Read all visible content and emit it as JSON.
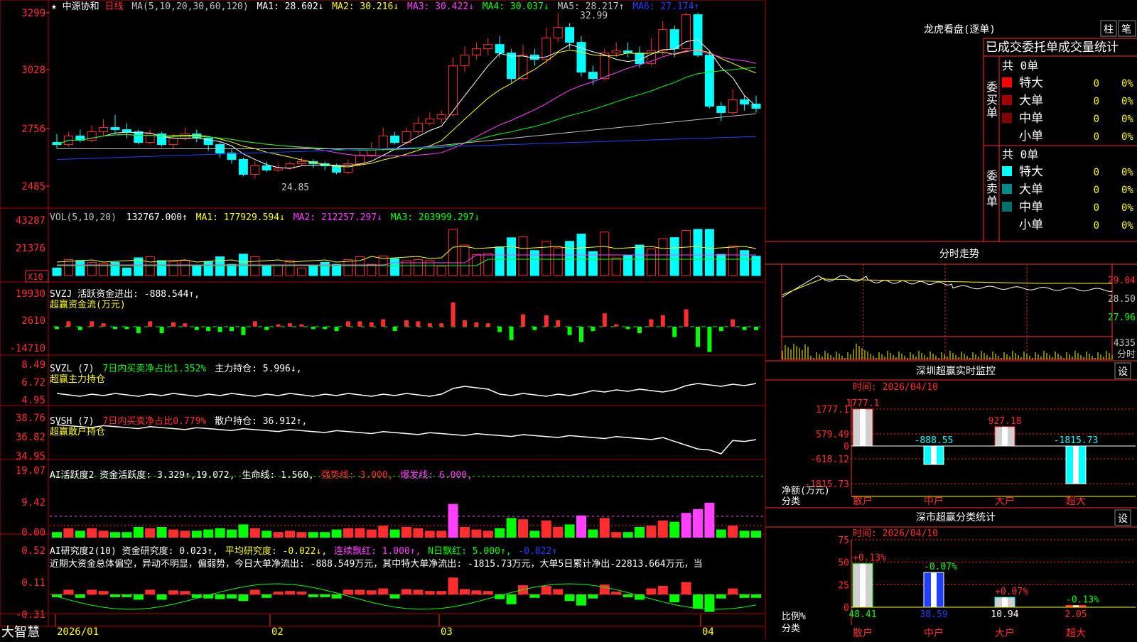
{
  "colors": {
    "up": "#ff2d2d",
    "down": "#00ffff",
    "grid": "#8b0000",
    "text": "#c0c0c0",
    "yellow": "#ffff00",
    "magenta": "#ff40ff",
    "green": "#00ff00",
    "white": "#ffffff",
    "blue": "#2040ff",
    "teal": "#008080"
  },
  "header": {
    "star": "★",
    "stock_name": "中源协和",
    "period": "日线",
    "ma_params": "MA(5,10,20,30,60,120)",
    "ma1": "MA1: 28.602↓",
    "ma2": "MA2: 30.216↓",
    "ma3": "MA3: 30.422↓",
    "ma4": "MA4: 30.037↓",
    "ma5": "MA5: 28.217↑",
    "ma6": "MA6: 27.174↑"
  },
  "kline": {
    "y_ticks": [
      "3299",
      "3028",
      "2756",
      "2485"
    ],
    "high_label": "32.99",
    "low_label": "24.85"
  },
  "volume": {
    "title": "VOL(5,10,20)",
    "value": "132767.000↑",
    "ma1": "MA1: 177929.594↓",
    "ma2": "MA2: 212257.297↓",
    "ma3": "MA3: 203999.297↓",
    "y_ticks": [
      "43287",
      "21376"
    ],
    "unit": "X10"
  },
  "svzj": {
    "line1": "SVZJ  活跃资金进出: -888.544↑,",
    "line2": "超赢资金流(万元)",
    "y_ticks": [
      "19930",
      "2610",
      "-14710"
    ]
  },
  "svzl": {
    "prefix": "SVZL (7)",
    "highlight": "7日内买卖净占比1.352%",
    "tail": "主力持仓: 5.996↓,",
    "line2": "超赢主力持仓",
    "y_ticks": [
      "8.49",
      "6.72",
      "4.95"
    ]
  },
  "svsh": {
    "prefix": "SVSH (7)",
    "highlight": "7日内买卖净占比0.779%",
    "tail": "散户持仓: 36.912↑,",
    "line2": "超赢散户持仓",
    "y_ticks": [
      "38.76",
      "36.82",
      "34.95"
    ]
  },
  "ai_active": {
    "title": "AI活跃度2 资金活跃度: 3.329↑,19.072,",
    "life": "生命线: 1.560,",
    "strong": "强势线: 3.000,",
    "burst": "爆发线: 6.000,",
    "y_ticks": [
      "19.07",
      "9.42",
      "0.00"
    ]
  },
  "ai_research": {
    "title": "AI研究度2(10) 资金研究度: 0.023↑,",
    "avg": "平均研究度: -0.022↓,",
    "cont": "连续飘红: 1.000↑,",
    "nday": "N日飘红: 5.000↑,",
    "last": "-0.022↑",
    "comment": "近期大资金总体偏空，异动不明显，偏弱势，今日大单净流出: -888.549万元，其中特大单净流出: -1815.73万元，大单5日累计净出-22813.664万元，当",
    "y_ticks": [
      "0.52",
      "0.11",
      "-0.31"
    ]
  },
  "xaxis": {
    "labels": [
      "2026/01",
      "02",
      "03",
      "04"
    ],
    "brand": "大智慧"
  },
  "right_top": {
    "title": "龙虎看盘(逐单)",
    "btn_bar": "柱",
    "btn_pen": "笔",
    "header": "已成交委托单成交量统计",
    "buy": {
      "side_label": [
        "委",
        "买",
        "单"
      ],
      "total": "共 0单",
      "rows": [
        {
          "name": "特大",
          "count": "0",
          "pct": "0%"
        },
        {
          "name": "大单",
          "count": "0",
          "pct": "0%"
        },
        {
          "name": "中单",
          "count": "0",
          "pct": "0%"
        },
        {
          "name": "小单",
          "count": "0",
          "pct": "0%"
        }
      ]
    },
    "sell": {
      "side_label": [
        "委",
        "卖",
        "单"
      ],
      "total": "共 0单",
      "rows": [
        {
          "name": "特大",
          "count": "0",
          "pct": "0%"
        },
        {
          "name": "大单",
          "count": "0",
          "pct": "0%"
        },
        {
          "name": "中单",
          "count": "0",
          "pct": "0%"
        },
        {
          "name": "小单",
          "count": "0",
          "pct": "0%"
        }
      ]
    }
  },
  "intraday": {
    "title": "分时走势",
    "y_ticks": [
      "29.04",
      "28.50",
      "27.96"
    ],
    "vol_label": "4335",
    "vol_unit": "分时"
  },
  "monitor": {
    "title": "深圳超赢实时监控",
    "btn": "设",
    "time": "时间: 2026/04/10",
    "y_ticks": [
      "1777.1",
      "579.49",
      "0",
      "-618.12",
      "-1815.73"
    ],
    "ylabel1": "净额(万元)",
    "ylabel2": "分类",
    "categories": [
      "散户",
      "中户",
      "大户",
      "超大"
    ]
  },
  "classify": {
    "title": "深市超赢分类统计",
    "btn": "设",
    "time": "时间: 2026/04/10",
    "y_ticks": [
      "75",
      "50",
      "25",
      "0"
    ],
    "ylabel1": "比例%",
    "ylabel2": "分类",
    "categories": [
      "散户",
      "中户",
      "大户",
      "超大"
    ]
  },
  "chart_data": [
    {
      "type": "bar",
      "title": "深圳超赢实时监控",
      "ylabel": "净额(万元)",
      "categories": [
        "散户",
        "中户",
        "大户",
        "超大"
      ],
      "values": [
        1777.1,
        -888.55,
        927.18,
        -1815.73
      ]
    },
    {
      "type": "bar",
      "title": "深市超赢分类统计",
      "ylabel": "比例%",
      "categories": [
        "散户",
        "中户",
        "大户",
        "超大"
      ],
      "values": [
        48.41,
        38.59,
        10.94,
        2.05
      ],
      "change_labels": [
        "+0.13%",
        "-0.07%",
        "+0.07%",
        "-0.13%"
      ],
      "ylim": [
        0,
        75
      ]
    },
    {
      "type": "candlestick",
      "title": "中源协和 日线",
      "ylim": [
        24.85,
        32.99
      ],
      "candles": [
        [
          26.9,
          26.8,
          27.3,
          26.6
        ],
        [
          26.8,
          27.2,
          27.4,
          26.7
        ],
        [
          27.2,
          27.0,
          27.5,
          26.9
        ],
        [
          27.0,
          27.4,
          27.7,
          26.9
        ],
        [
          27.4,
          27.6,
          28.0,
          27.2
        ],
        [
          27.6,
          27.5,
          28.2,
          27.3
        ],
        [
          27.5,
          27.4,
          27.8,
          27.1
        ],
        [
          27.4,
          26.9,
          27.5,
          26.8
        ],
        [
          26.9,
          27.3,
          27.5,
          26.8
        ],
        [
          27.3,
          26.8,
          27.4,
          26.7
        ],
        [
          26.8,
          27.1,
          27.3,
          26.6
        ],
        [
          27.1,
          27.3,
          27.6,
          27.0
        ],
        [
          27.3,
          27.1,
          27.5,
          26.9
        ],
        [
          27.1,
          26.8,
          27.2,
          26.5
        ],
        [
          26.8,
          26.4,
          26.9,
          26.2
        ],
        [
          26.4,
          26.1,
          26.6,
          25.9
        ],
        [
          26.1,
          25.4,
          26.2,
          25.3
        ],
        [
          25.4,
          25.8,
          26.0,
          25.2
        ],
        [
          25.8,
          25.6,
          26.0,
          25.5
        ],
        [
          25.6,
          25.7,
          25.9,
          25.5
        ],
        [
          25.7,
          25.9,
          26.0,
          25.6
        ],
        [
          25.9,
          26.0,
          26.2,
          25.8
        ],
        [
          26.0,
          25.9,
          26.1,
          25.7
        ],
        [
          25.9,
          25.8,
          26.0,
          25.6
        ],
        [
          25.8,
          25.5,
          25.9,
          25.4
        ],
        [
          25.5,
          25.9,
          26.1,
          25.4
        ],
        [
          25.9,
          26.3,
          26.5,
          25.8
        ],
        [
          26.3,
          26.6,
          26.9,
          26.2
        ],
        [
          26.6,
          27.2,
          27.6,
          26.5
        ],
        [
          27.2,
          26.9,
          27.4,
          26.8
        ],
        [
          26.9,
          27.4,
          27.6,
          26.8
        ],
        [
          27.4,
          27.8,
          28.1,
          27.3
        ],
        [
          27.8,
          28.0,
          28.3,
          27.7
        ],
        [
          28.0,
          28.2,
          28.4,
          27.8
        ],
        [
          28.2,
          30.5,
          30.9,
          28.1
        ],
        [
          30.5,
          31.0,
          31.4,
          30.2
        ],
        [
          31.0,
          31.3,
          31.6,
          30.8
        ],
        [
          31.3,
          31.5,
          31.8,
          31.0
        ],
        [
          31.5,
          31.1,
          31.9,
          30.9
        ],
        [
          31.1,
          29.9,
          31.3,
          29.7
        ],
        [
          29.9,
          31.0,
          31.5,
          29.8
        ],
        [
          31.0,
          30.8,
          31.3,
          30.5
        ],
        [
          30.8,
          31.8,
          32.3,
          30.6
        ],
        [
          31.8,
          32.3,
          32.99,
          31.6
        ],
        [
          32.3,
          31.6,
          32.5,
          31.3
        ],
        [
          31.6,
          30.2,
          31.9,
          30.0
        ],
        [
          30.2,
          29.9,
          30.5,
          29.6
        ],
        [
          29.9,
          31.1,
          31.3,
          29.8
        ],
        [
          31.1,
          31.2,
          31.6,
          30.9
        ],
        [
          31.2,
          31.1,
          31.6,
          30.9
        ],
        [
          31.1,
          30.6,
          31.4,
          30.4
        ],
        [
          30.6,
          31.2,
          31.8,
          30.5
        ],
        [
          31.2,
          32.2,
          32.6,
          31.0
        ],
        [
          32.2,
          31.3,
          32.4,
          30.9
        ],
        [
          31.3,
          32.9,
          33.0,
          31.1
        ],
        [
          32.9,
          31.0,
          33.0,
          30.9
        ],
        [
          31.0,
          28.6,
          31.2,
          28.5
        ],
        [
          28.6,
          28.3,
          28.8,
          27.9
        ],
        [
          28.3,
          28.9,
          29.4,
          28.2
        ],
        [
          28.9,
          28.7,
          29.1,
          28.4
        ],
        [
          28.7,
          28.5,
          29.1,
          28.3
        ]
      ]
    }
  ]
}
